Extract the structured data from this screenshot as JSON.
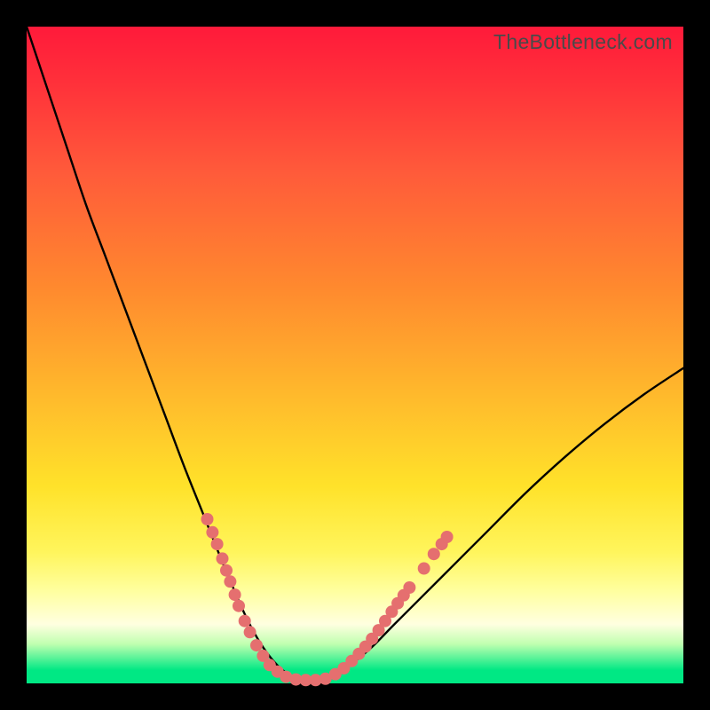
{
  "watermark": "TheBottleneck.com",
  "colors": {
    "curve_stroke": "#000000",
    "dot_fill": "#e56f6f",
    "background_black": "#000000",
    "grad_top": "#ff1a3a",
    "grad_bottom": "#00e884"
  },
  "chart_data": {
    "type": "line",
    "title": "",
    "xlabel": "",
    "ylabel": "",
    "xlim": [
      0,
      100
    ],
    "ylim": [
      0,
      100
    ],
    "grid": false,
    "legend": false,
    "annotations": [
      "TheBottleneck.com"
    ],
    "series": [
      {
        "name": "bottleneck-curve",
        "x": [
          0,
          3,
          6,
          9,
          12,
          15,
          18,
          21,
          24,
          27,
          30,
          33,
          34.5,
          36,
          37.5,
          39,
          40.5,
          42,
          45,
          48,
          52,
          56,
          60,
          65,
          70,
          76,
          82,
          88,
          94,
          100
        ],
        "y": [
          100,
          91,
          82,
          73,
          65,
          57,
          49,
          41,
          33,
          25.5,
          18,
          11,
          8,
          5.5,
          3.5,
          2,
          1,
          0.5,
          0.5,
          2,
          5,
          9,
          13,
          18,
          23,
          29,
          34.5,
          39.5,
          44,
          48
        ]
      }
    ],
    "dots": [
      {
        "x": 27.5,
        "y": 25
      },
      {
        "x": 28.3,
        "y": 23
      },
      {
        "x": 29.0,
        "y": 21.2
      },
      {
        "x": 29.8,
        "y": 19
      },
      {
        "x": 30.4,
        "y": 17.2
      },
      {
        "x": 31.0,
        "y": 15.5
      },
      {
        "x": 31.7,
        "y": 13.5
      },
      {
        "x": 32.3,
        "y": 11.8
      },
      {
        "x": 33.2,
        "y": 9.5
      },
      {
        "x": 34.0,
        "y": 7.8
      },
      {
        "x": 35.0,
        "y": 5.8
      },
      {
        "x": 36.0,
        "y": 4.2
      },
      {
        "x": 37.0,
        "y": 2.8
      },
      {
        "x": 38.2,
        "y": 1.8
      },
      {
        "x": 39.5,
        "y": 1.0
      },
      {
        "x": 41.0,
        "y": 0.6
      },
      {
        "x": 42.5,
        "y": 0.5
      },
      {
        "x": 44.0,
        "y": 0.5
      },
      {
        "x": 45.5,
        "y": 0.7
      },
      {
        "x": 47.0,
        "y": 1.4
      },
      {
        "x": 48.3,
        "y": 2.3
      },
      {
        "x": 49.5,
        "y": 3.4
      },
      {
        "x": 50.6,
        "y": 4.5
      },
      {
        "x": 51.6,
        "y": 5.6
      },
      {
        "x": 52.6,
        "y": 6.8
      },
      {
        "x": 53.6,
        "y": 8.1
      },
      {
        "x": 54.6,
        "y": 9.5
      },
      {
        "x": 55.6,
        "y": 10.9
      },
      {
        "x": 56.5,
        "y": 12.2
      },
      {
        "x": 57.4,
        "y": 13.4
      },
      {
        "x": 58.3,
        "y": 14.6
      },
      {
        "x": 60.5,
        "y": 17.5
      },
      {
        "x": 62.0,
        "y": 19.7
      },
      {
        "x": 63.2,
        "y": 21.2
      },
      {
        "x": 64.0,
        "y": 22.3
      }
    ]
  }
}
